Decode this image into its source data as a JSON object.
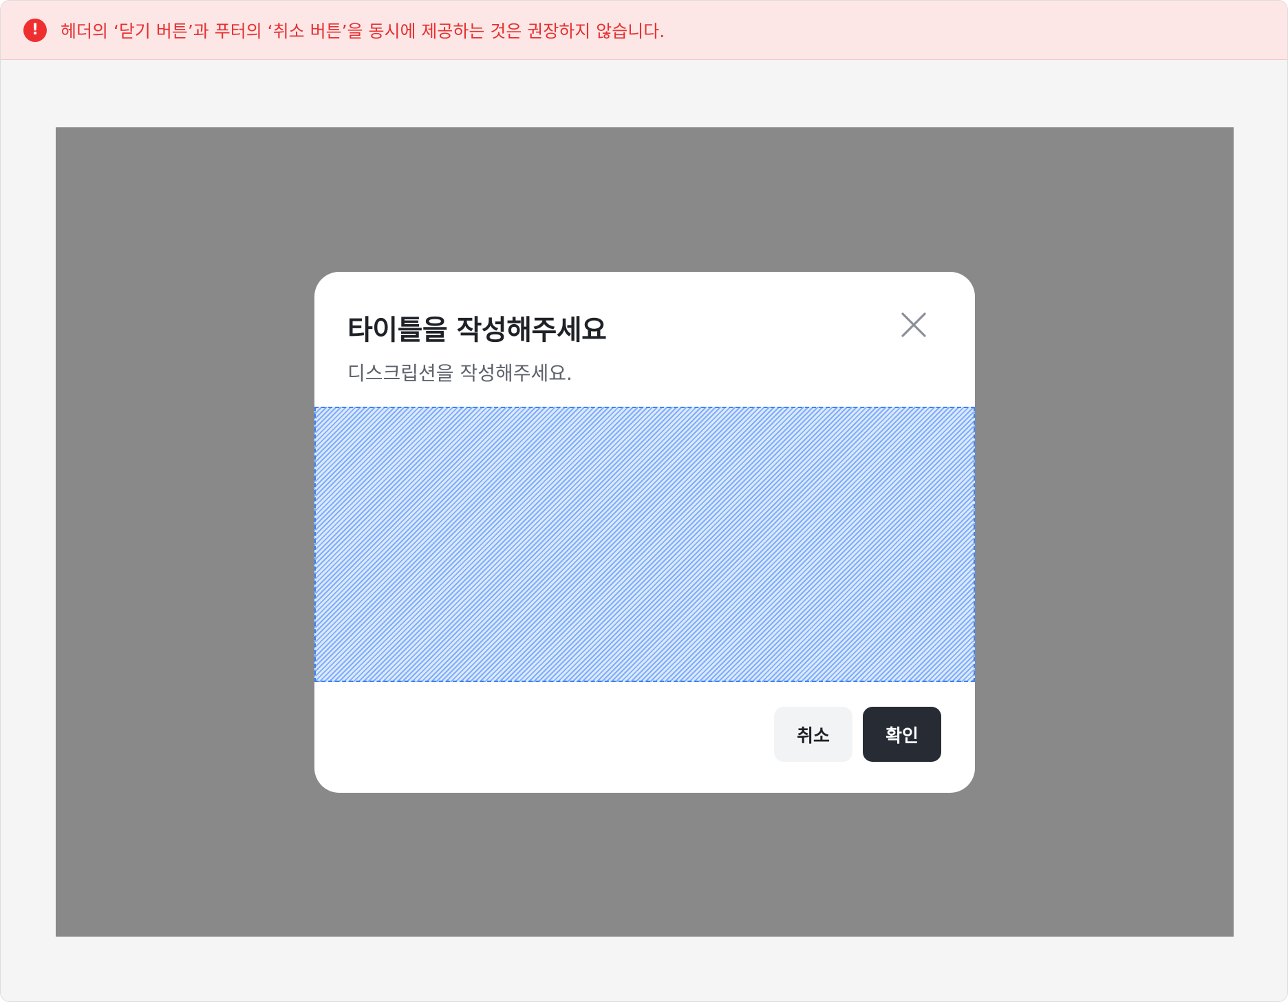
{
  "alert": {
    "icon": "exclamation-icon",
    "icon_glyph": "!",
    "message": "헤더의 ‘닫기 버튼’과 푸터의 ‘취소 버튼’을 동시에 제공하는 것은 권장하지 않습니다.",
    "colors": {
      "background": "#fde6e6",
      "icon": "#ef2f2f",
      "text": "#e53030"
    }
  },
  "modal": {
    "title": "타이틀을 작성해주세요",
    "description": "디스크립션을 작성해주세요.",
    "close_icon": "close-icon",
    "slot_colors": {
      "border": "#3b82f6",
      "fill": "#dbe9ff"
    },
    "footer": {
      "cancel_label": "취소",
      "confirm_label": "확인"
    },
    "colors": {
      "overlay": "#898989",
      "confirm_button": "#272c34",
      "cancel_button": "#f2f3f5"
    }
  }
}
